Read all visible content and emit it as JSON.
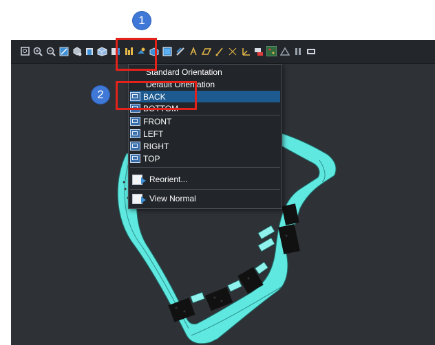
{
  "toolbar": {
    "icons": [
      "zoom-fit-icon",
      "zoom-in-icon",
      "zoom-out-icon",
      "zoom-area-icon",
      "rotate-icon",
      "section-view-icon",
      "view-orientation-icon",
      "display-style-icon",
      "view-layout-icon",
      "render-icon",
      "shaded-icon",
      "shaded-edges-icon",
      "wireframe-icon",
      "datum-display-icon",
      "datum-plane-icon",
      "datum-axis-icon",
      "datum-point-icon",
      "coordinate-system-icon",
      "annotation-icon",
      "spin-center-icon",
      "appearance-icon",
      "pause-icon",
      "more-icon"
    ]
  },
  "orientation_menu": {
    "header_items": [
      {
        "label": "Standard Orientation"
      },
      {
        "label": "Default Orientation"
      }
    ],
    "views": [
      {
        "label": "BACK",
        "selected": true
      },
      {
        "label": "BOTTOM",
        "selected": false
      },
      {
        "label": "FRONT",
        "selected": false
      },
      {
        "label": "LEFT",
        "selected": false
      },
      {
        "label": "RIGHT",
        "selected": false
      },
      {
        "label": "TOP",
        "selected": false
      }
    ],
    "actions": [
      {
        "label": "Reorient..."
      },
      {
        "label": "View Normal"
      }
    ]
  },
  "callouts": [
    {
      "label": "1"
    },
    {
      "label": "2"
    }
  ],
  "colors": {
    "background": "#2e3136",
    "part": "#5fe8e0",
    "highlight": "#e3231b",
    "selection": "#1d5a8f",
    "callout": "#3f78d6"
  }
}
